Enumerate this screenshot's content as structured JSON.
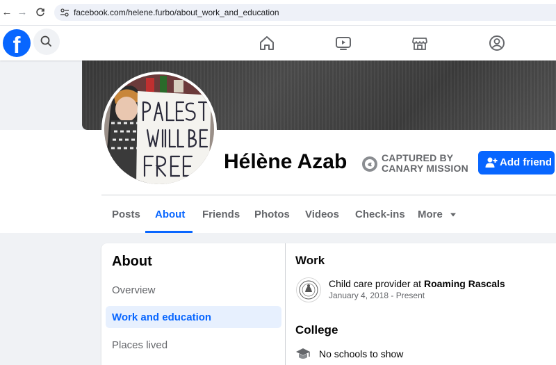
{
  "browser": {
    "url": "facebook.com/helene.furbo/about_work_and_education",
    "back_icon": "arrow-left-icon",
    "forward_icon": "arrow-right-icon",
    "reload_icon": "reload-icon"
  },
  "fbnav": {
    "logo_letter": "f",
    "icons": [
      "home-icon",
      "watch-icon",
      "marketplace-icon",
      "groups-icon"
    ]
  },
  "profile": {
    "name": "Hélène Azab",
    "captured_line1": "CAPTURED BY",
    "captured_line2": "CANARY MISSION",
    "add_friend_label": "Add friend"
  },
  "tabs": [
    {
      "label": "Posts"
    },
    {
      "label": "About",
      "active": true
    },
    {
      "label": "Friends"
    },
    {
      "label": "Photos"
    },
    {
      "label": "Videos"
    },
    {
      "label": "Check-ins"
    },
    {
      "label": "More"
    }
  ],
  "about": {
    "title": "About",
    "menu": [
      {
        "label": "Overview"
      },
      {
        "label": "Work and education",
        "active": true
      },
      {
        "label": "Places lived"
      }
    ],
    "work": {
      "heading": "Work",
      "role_prefix": "Child care provider at",
      "employer": "Roaming Rascals",
      "dates": "January 4, 2018 - Present"
    },
    "college": {
      "heading": "College",
      "empty_text": "No schools to show"
    }
  },
  "colors": {
    "accent": "#0866ff",
    "background": "#f0f2f5",
    "muted_text": "#65676b"
  }
}
